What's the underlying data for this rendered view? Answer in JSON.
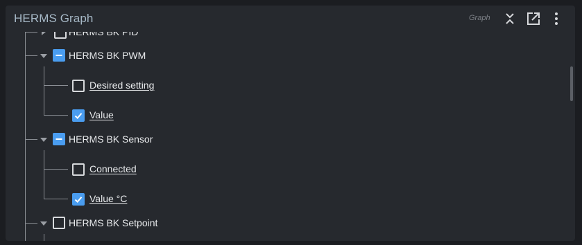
{
  "header": {
    "title": "HERMS Graph",
    "type_label": "Graph",
    "icons": [
      "collapse-icon",
      "open-external-icon",
      "more-vert-icon"
    ]
  },
  "tree": {
    "partial_top_label": "HERMS BK PID",
    "groups": [
      {
        "label": "HERMS BK PWM",
        "state": "indeterminate",
        "expanded": true,
        "children": [
          {
            "label": "Desired setting",
            "checked": false
          },
          {
            "label": "Value",
            "checked": true
          }
        ]
      },
      {
        "label": "HERMS BK Sensor",
        "state": "indeterminate",
        "expanded": true,
        "children": [
          {
            "label": "Connected",
            "checked": false
          },
          {
            "label": "Value °C",
            "checked": true
          }
        ]
      },
      {
        "label": "HERMS BK Setpoint",
        "state": "unchecked",
        "expanded": true,
        "children": []
      }
    ]
  },
  "colors": {
    "background": "#1b1d21",
    "panel": "#26292e",
    "accent": "#4a9df0",
    "title": "#a6b8c6",
    "text": "#e8eaec"
  }
}
